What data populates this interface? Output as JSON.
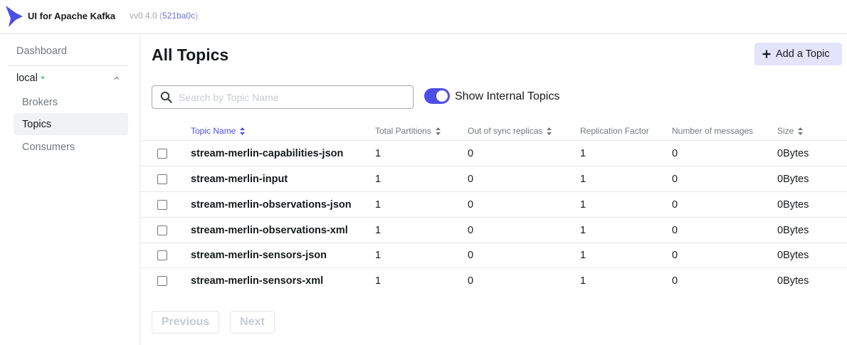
{
  "navbar": {
    "app_title": "UI for Apache Kafka",
    "version_prefix": "vv0.4.0 (",
    "version_hash": "521ba0c",
    "version_suffix": ")"
  },
  "sidebar": {
    "dashboard": "Dashboard",
    "cluster_name": "local",
    "cluster_status_color": "#5cd685",
    "items": [
      {
        "label": "Brokers",
        "active": false
      },
      {
        "label": "Topics",
        "active": true
      },
      {
        "label": "Consumers",
        "active": false
      }
    ]
  },
  "main": {
    "title": "All Topics",
    "add_button_label": "Add a Topic",
    "search_placeholder": "Search by Topic Name",
    "search_value": "",
    "toggle_label": "Show Internal Topics",
    "toggle_on": true,
    "accent_color": "#4f4ee4"
  },
  "table": {
    "headers": {
      "name": "Topic Name",
      "partitions": "Total Partitions",
      "out_of_sync": "Out of sync replicas",
      "replication": "Replication Factor",
      "messages": "Number of messages",
      "size": "Size"
    },
    "rows": [
      {
        "name": "stream-merlin-capabilities-json",
        "partitions": "1",
        "out_of_sync": "0",
        "replication": "1",
        "messages": "0",
        "size": "0Bytes"
      },
      {
        "name": "stream-merlin-input",
        "partitions": "1",
        "out_of_sync": "0",
        "replication": "1",
        "messages": "0",
        "size": "0Bytes"
      },
      {
        "name": "stream-merlin-observations-json",
        "partitions": "1",
        "out_of_sync": "0",
        "replication": "1",
        "messages": "0",
        "size": "0Bytes"
      },
      {
        "name": "stream-merlin-observations-xml",
        "partitions": "1",
        "out_of_sync": "0",
        "replication": "1",
        "messages": "0",
        "size": "0Bytes"
      },
      {
        "name": "stream-merlin-sensors-json",
        "partitions": "1",
        "out_of_sync": "0",
        "replication": "1",
        "messages": "0",
        "size": "0Bytes"
      },
      {
        "name": "stream-merlin-sensors-xml",
        "partitions": "1",
        "out_of_sync": "0",
        "replication": "1",
        "messages": "0",
        "size": "0Bytes"
      }
    ]
  },
  "pagination": {
    "previous": "Previous",
    "next": "Next"
  }
}
